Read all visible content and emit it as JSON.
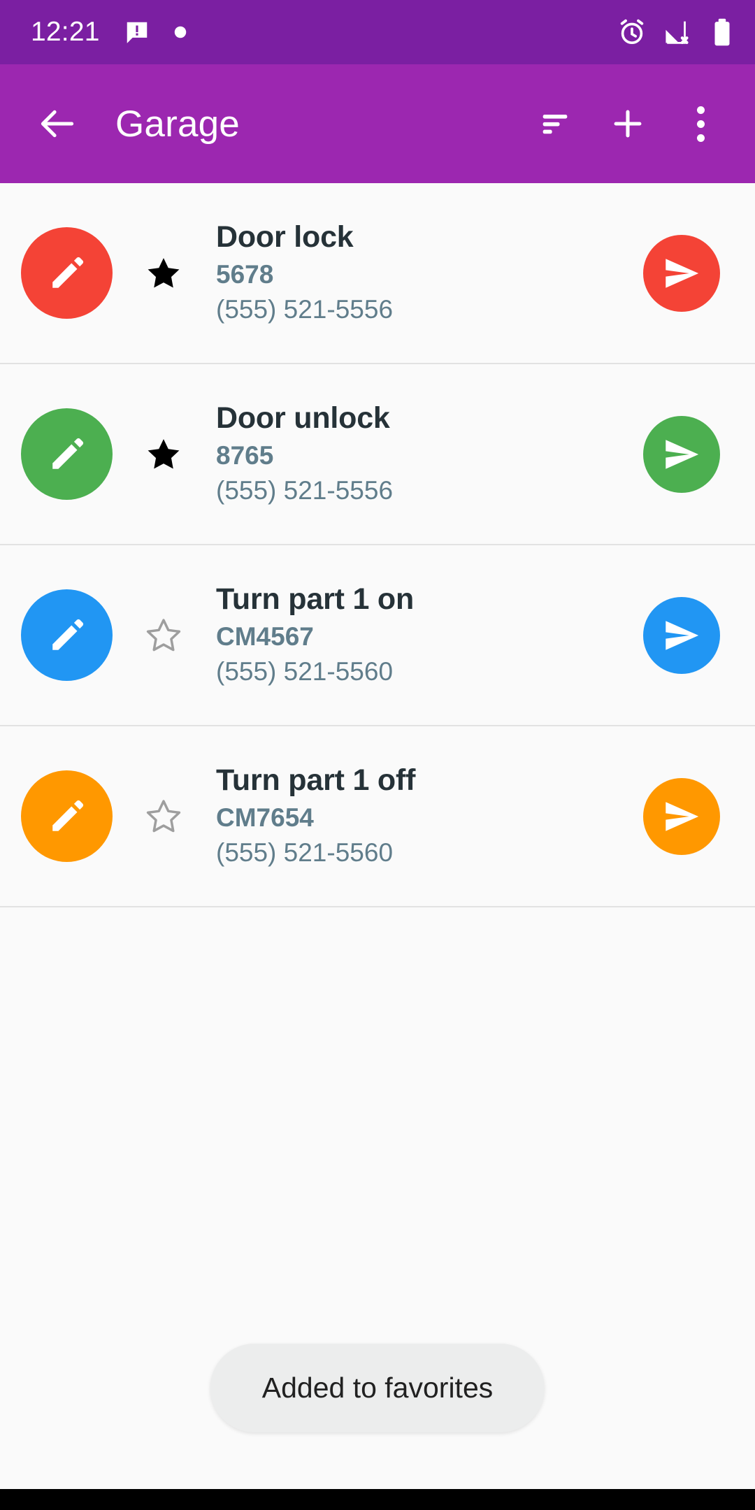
{
  "status_bar": {
    "clock": "12:21",
    "background": "#7b1fa2",
    "left_icons": [
      "message-alert-icon",
      "dot-icon"
    ],
    "right_icons": [
      "alarm-icon",
      "signal-off-icon",
      "battery-icon"
    ]
  },
  "app_bar": {
    "title": "Garage",
    "background": "#9c27b0",
    "back_icon": "arrow-back-icon",
    "actions": [
      {
        "name": "sort-icon",
        "label": "Sort"
      },
      {
        "name": "add-icon",
        "label": "Add"
      },
      {
        "name": "overflow-menu-icon",
        "label": "More options"
      }
    ]
  },
  "list": {
    "items": [
      {
        "title": "Door lock",
        "code": "5678",
        "phone": "(555) 521-5556",
        "color": "#f44336",
        "favorite": true,
        "edit_icon": "pencil-icon",
        "send_icon": "send-icon"
      },
      {
        "title": "Door unlock",
        "code": "8765",
        "phone": "(555) 521-5556",
        "color": "#4caf50",
        "favorite": true,
        "edit_icon": "pencil-icon",
        "send_icon": "send-icon"
      },
      {
        "title": "Turn part 1 on",
        "code": "CM4567",
        "phone": "(555) 521-5560",
        "color": "#2196f3",
        "favorite": false,
        "edit_icon": "pencil-icon",
        "send_icon": "send-icon"
      },
      {
        "title": "Turn part 1 off",
        "code": "CM7654",
        "phone": "(555) 521-5560",
        "color": "#ff9800",
        "favorite": false,
        "edit_icon": "pencil-icon",
        "send_icon": "send-icon"
      }
    ]
  },
  "toast": {
    "message": "Added to favorites",
    "background": "#eceded"
  },
  "theme": {
    "primary": "#9c27b0",
    "primary_dark": "#7b1fa2",
    "page_background": "#fafafa",
    "title_text": "#263238",
    "secondary_text": "#607d8b",
    "divider": "#e2e2e2",
    "star_on": "#000000",
    "star_off": "#9e9e9e"
  }
}
